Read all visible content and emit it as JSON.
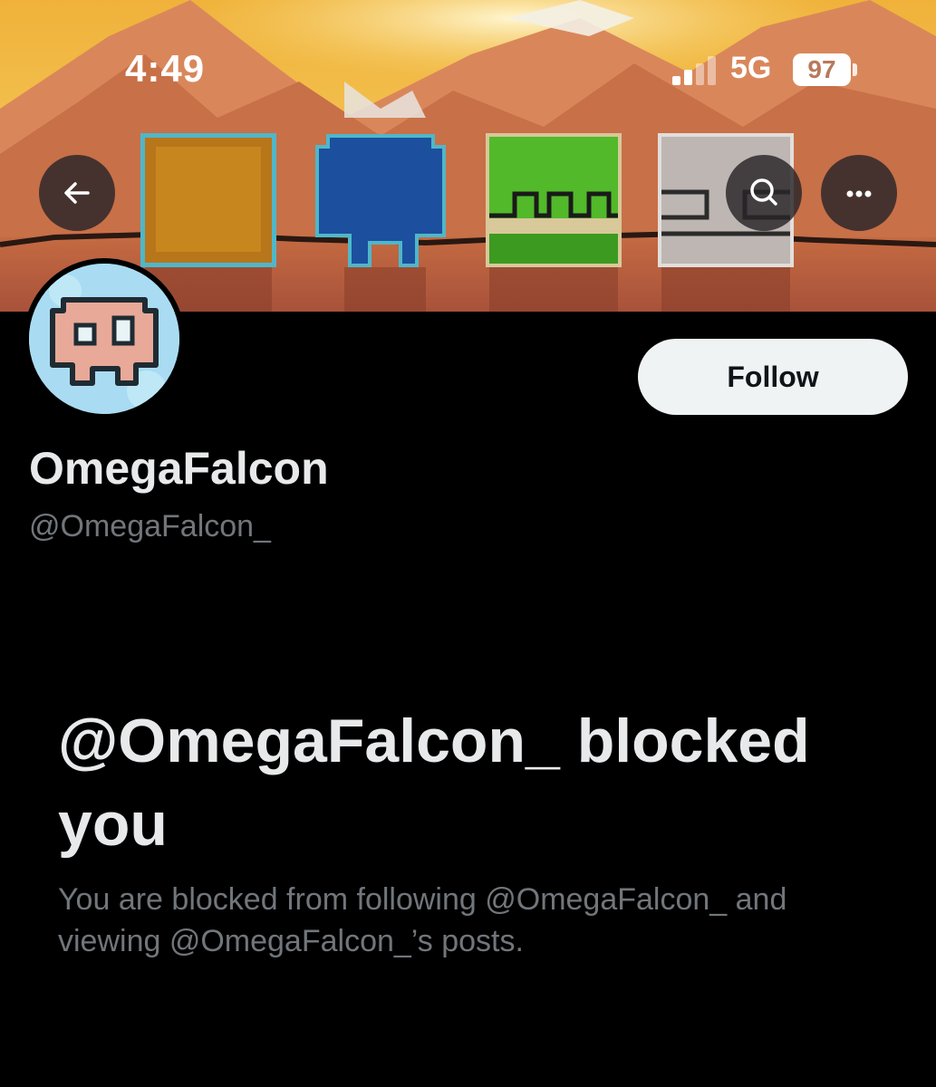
{
  "status_bar": {
    "time": "4:49",
    "network": "5G",
    "battery": "97"
  },
  "banner": {
    "icon_names": [
      "back-arrow-icon",
      "search-icon",
      "more-dots-icon"
    ]
  },
  "profile": {
    "display_name": "OmegaFalcon",
    "handle": "@OmegaFalcon_",
    "follow_label": "Follow"
  },
  "blocked": {
    "title": "@OmegaFalcon_ blocked you",
    "description": "You are blocked from following @OmegaFalcon_ and viewing @OmegaFalcon_’s posts."
  },
  "colors": {
    "background": "#000000",
    "primary_text": "#e7e9ea",
    "secondary_text": "#71767b",
    "follow_button_bg": "#eff3f4"
  }
}
